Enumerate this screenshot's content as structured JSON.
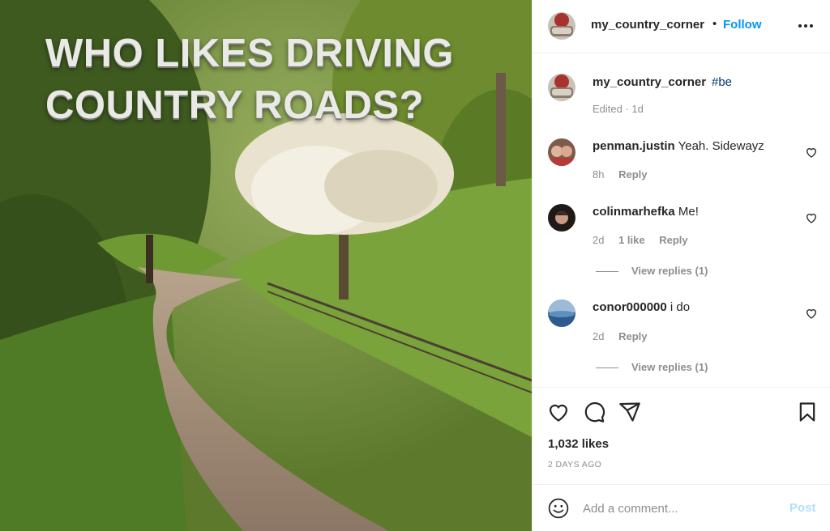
{
  "post": {
    "overlay_lines": [
      "WHO LIKES DRIVING",
      "COUNTRY ROADS?"
    ]
  },
  "header": {
    "username": "my_country_corner",
    "separator": "•",
    "follow_label": "Follow",
    "more_icon": "more-horizontal-icon"
  },
  "caption": {
    "username": "my_country_corner",
    "hashtag": "#be",
    "edited": "Edited · 1d"
  },
  "comments": [
    {
      "username": "penman.justin",
      "text": "Yeah. Sidewayz",
      "time": "8h",
      "likes": "",
      "reply_label": "Reply",
      "view_replies": ""
    },
    {
      "username": "colinmarhefka",
      "text": "Me!",
      "time": "2d",
      "likes": "1 like",
      "reply_label": "Reply",
      "view_replies": "View replies (1)"
    },
    {
      "username": "conor000000",
      "text": "i do",
      "time": "2d",
      "likes": "",
      "reply_label": "Reply",
      "view_replies": "View replies (1)"
    }
  ],
  "actions": {
    "icons": [
      "heart-icon",
      "comment-icon",
      "share-icon",
      "bookmark-icon"
    ],
    "likes_text": "1,032 likes",
    "date_text": "2 DAYS AGO"
  },
  "add_comment": {
    "placeholder": "Add a comment...",
    "post_label": "Post",
    "emoji_icon": "emoji-icon"
  },
  "colors": {
    "follow": "#0095f6",
    "hashtag": "#00376b",
    "secondary_text": "#8e8e8e",
    "post_disabled": "#b2dffc"
  }
}
